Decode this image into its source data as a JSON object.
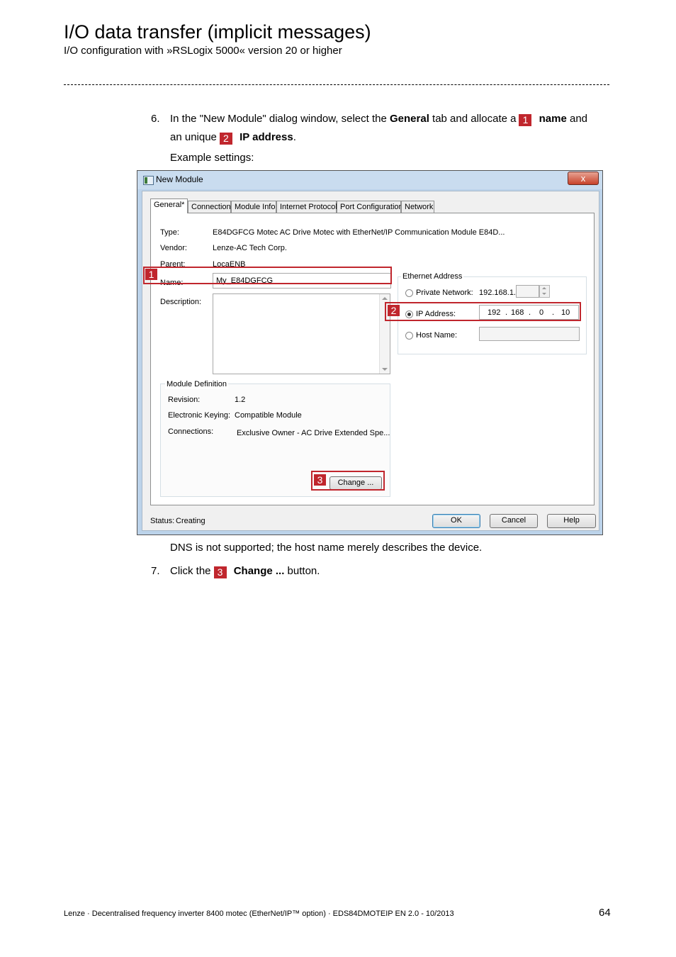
{
  "header": {
    "title": "I/O data transfer (implicit messages)",
    "subtitle": "I/O configuration with »RSLogix 5000« version 20 or higher"
  },
  "step6": {
    "num": "6.",
    "line1_a": "In the \"New Module\" dialog window, select the ",
    "line1_b": "General",
    "line1_c": " tab and allocate a",
    "badge1": "1",
    "line1_d": "name",
    "line1_e": " and",
    "line2_a": "an unique",
    "badge2": "2",
    "line2_b": "IP address",
    "line2_c": ".",
    "example": "Example settings:"
  },
  "dialog": {
    "title": "New Module",
    "close": "x",
    "tabs": [
      "General*",
      "Connection",
      "Module Info",
      "Internet Protocol",
      "Port Configuration",
      "Network"
    ],
    "type_label": "Type:",
    "type_value": "E84DGFCG Motec AC Drive Motec with EtherNet/IP Communication Module E84D...",
    "vendor_label": "Vendor:",
    "vendor_value": "Lenze-AC Tech Corp.",
    "parent_label": "Parent:",
    "parent_value": "LocaENB",
    "name_label": "Name:",
    "name_value": "My_E84DGFCG",
    "description_label": "Description:",
    "ethernet_title": "Ethernet Address",
    "private_label": "Private Network:",
    "private_prefix": "192.168.1.",
    "ip_label": "IP Address:",
    "ip": [
      "192",
      "168",
      "0",
      "10"
    ],
    "host_label": "Host Name:",
    "moddef_title": "Module Definition",
    "revision_label": "Revision:",
    "revision_value": "1.2",
    "keying_label": "Electronic Keying:",
    "keying_value": "Compatible Module",
    "connections_label": "Connections:",
    "connections_value": "Exclusive Owner - AC Drive Extended Spe...",
    "change_button": "Change ...",
    "status_label": "Status:",
    "status_value": "Creating",
    "ok": "OK",
    "cancel": "Cancel",
    "help": "Help",
    "callouts": [
      "1",
      "2",
      "3"
    ]
  },
  "dns_note": "DNS is not supported; the host name merely describes the device.",
  "step7": {
    "num": "7.",
    "text_a": "Click the",
    "badge3": "3",
    "text_b": "Change ...",
    "text_c": " button."
  },
  "footer": {
    "text": "Lenze · Decentralised frequency inverter 8400 motec (EtherNet/IP™ option) · EDS84DMOTEIP EN 2.0 - 10/2013",
    "page": "64"
  }
}
